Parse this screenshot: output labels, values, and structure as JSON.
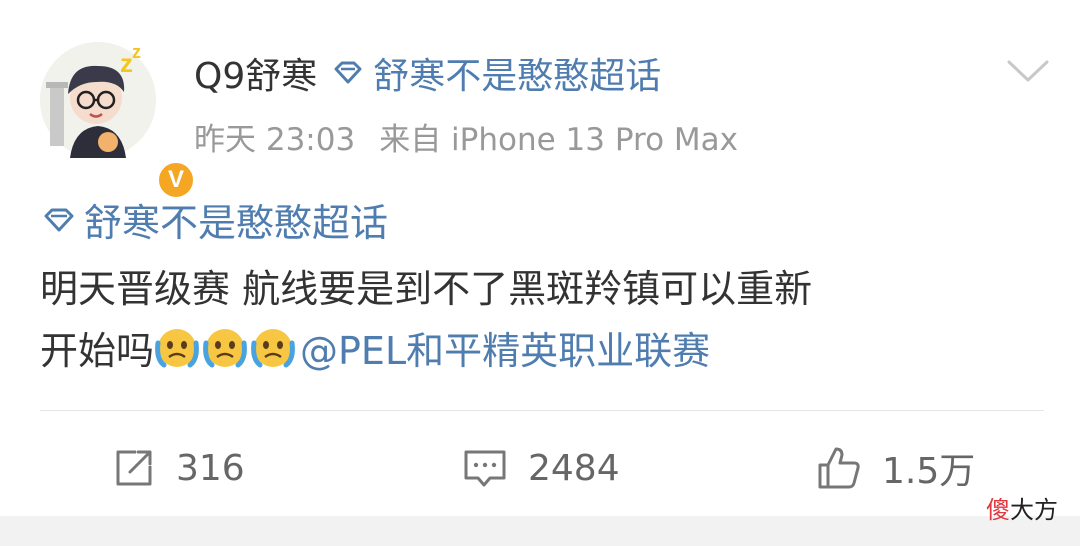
{
  "post": {
    "username": "Q9舒寒",
    "super_topic": "舒寒不是憨憨超话",
    "time": "昨天 23:03",
    "source": "来自 iPhone 13 Pro Max",
    "verified_badge": "V",
    "body_topic": "舒寒不是憨憨超话",
    "text_line1": "明天晋级赛 航线要是到不了黑斑羚镇可以重新",
    "text_line2": "开始吗",
    "mention": "@PEL和平精英职业联赛",
    "emojis": [
      "crying-face",
      "crying-face",
      "crying-face"
    ]
  },
  "actions": {
    "repost_count": "316",
    "comment_count": "2484",
    "like_count": "1.5万"
  },
  "watermark": {
    "part1": "傻",
    "part2": "大方"
  },
  "colors": {
    "link": "#507daf",
    "meta": "#999999",
    "text": "#333333",
    "badge": "#f5a623"
  }
}
